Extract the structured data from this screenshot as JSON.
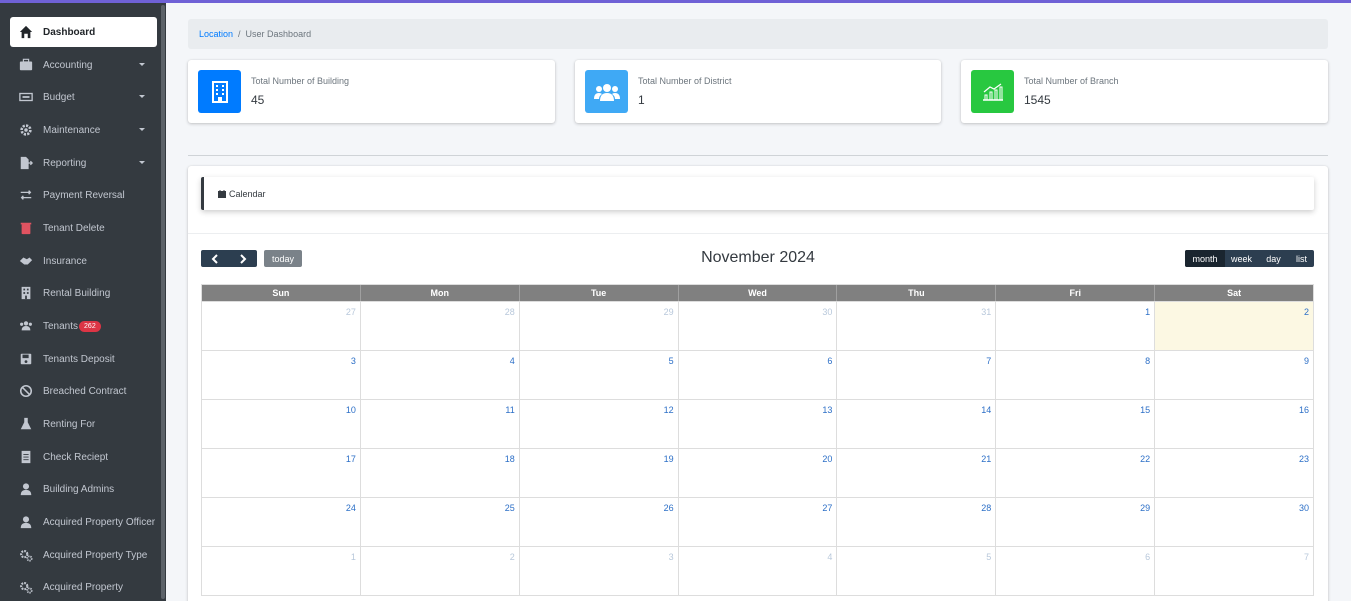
{
  "sidebar": {
    "items": [
      {
        "label": "Dashboard",
        "icon": "home-icon",
        "active": true
      },
      {
        "label": "Accounting",
        "icon": "briefcase-icon",
        "caret": true
      },
      {
        "label": "Budget",
        "icon": "money-bill-icon",
        "caret": true
      },
      {
        "label": "Maintenance",
        "icon": "gear-icon",
        "caret": true
      },
      {
        "label": "Reporting",
        "icon": "file-export-icon",
        "caret": true
      },
      {
        "label": "Payment Reversal",
        "icon": "exchange-icon"
      },
      {
        "label": "Tenant Delete",
        "icon": "trash-icon"
      },
      {
        "label": "Insurance",
        "icon": "handshake-icon"
      },
      {
        "label": "Rental Building",
        "icon": "building-icon"
      },
      {
        "label": "Tenants",
        "icon": "users-icon",
        "badge": "262"
      },
      {
        "label": "Tenants Deposit",
        "icon": "save-icon"
      },
      {
        "label": "Breached Contract",
        "icon": "ban-icon"
      },
      {
        "label": "Renting For",
        "icon": "flask-icon"
      },
      {
        "label": "Check Reciept",
        "icon": "receipt-icon"
      },
      {
        "label": "Building Admins",
        "icon": "user-icon"
      },
      {
        "label": "Acquired Property Officer",
        "icon": "user-icon"
      },
      {
        "label": "Acquired Property Type",
        "icon": "cogs-icon"
      },
      {
        "label": "Acquired Property",
        "icon": "cogs-icon"
      }
    ]
  },
  "breadcrumb": {
    "link": "Location",
    "separator": "/",
    "current": "User Dashboard"
  },
  "info_boxes": [
    {
      "label": "Total Number of Building",
      "value": "45",
      "color": "#007bff",
      "icon": "building-icon"
    },
    {
      "label": "Total Number of District",
      "value": "1",
      "color": "#3fa9f5",
      "icon": "users-icon"
    },
    {
      "label": "Total Number of Branch",
      "value": "1545",
      "color": "#28c840",
      "icon": "chart-line-icon"
    }
  ],
  "calendar": {
    "header_label": "Calendar",
    "title": "November 2024",
    "today_label": "today",
    "views": [
      "month",
      "week",
      "day",
      "list"
    ],
    "active_view": "month",
    "day_names": [
      "Sun",
      "Mon",
      "Tue",
      "Wed",
      "Thu",
      "Fri",
      "Sat"
    ],
    "weeks": [
      [
        {
          "d": "27",
          "o": true
        },
        {
          "d": "28",
          "o": true
        },
        {
          "d": "29",
          "o": true
        },
        {
          "d": "30",
          "o": true
        },
        {
          "d": "31",
          "o": true
        },
        {
          "d": "1"
        },
        {
          "d": "2",
          "t": true
        }
      ],
      [
        {
          "d": "3"
        },
        {
          "d": "4"
        },
        {
          "d": "5"
        },
        {
          "d": "6"
        },
        {
          "d": "7"
        },
        {
          "d": "8"
        },
        {
          "d": "9"
        }
      ],
      [
        {
          "d": "10"
        },
        {
          "d": "11"
        },
        {
          "d": "12"
        },
        {
          "d": "13"
        },
        {
          "d": "14"
        },
        {
          "d": "15"
        },
        {
          "d": "16"
        }
      ],
      [
        {
          "d": "17"
        },
        {
          "d": "18"
        },
        {
          "d": "19"
        },
        {
          "d": "20"
        },
        {
          "d": "21"
        },
        {
          "d": "22"
        },
        {
          "d": "23"
        }
      ],
      [
        {
          "d": "24"
        },
        {
          "d": "25"
        },
        {
          "d": "26"
        },
        {
          "d": "27"
        },
        {
          "d": "28"
        },
        {
          "d": "29"
        },
        {
          "d": "30"
        }
      ],
      [
        {
          "d": "1",
          "o": true
        },
        {
          "d": "2",
          "o": true
        },
        {
          "d": "3",
          "o": true
        },
        {
          "d": "4",
          "o": true
        },
        {
          "d": "5",
          "o": true
        },
        {
          "d": "6",
          "o": true
        },
        {
          "d": "7",
          "o": true
        }
      ]
    ]
  },
  "colors": {
    "sidebar": "#343a40",
    "accent": "#6f61d6",
    "today": "#fcf8e3"
  }
}
